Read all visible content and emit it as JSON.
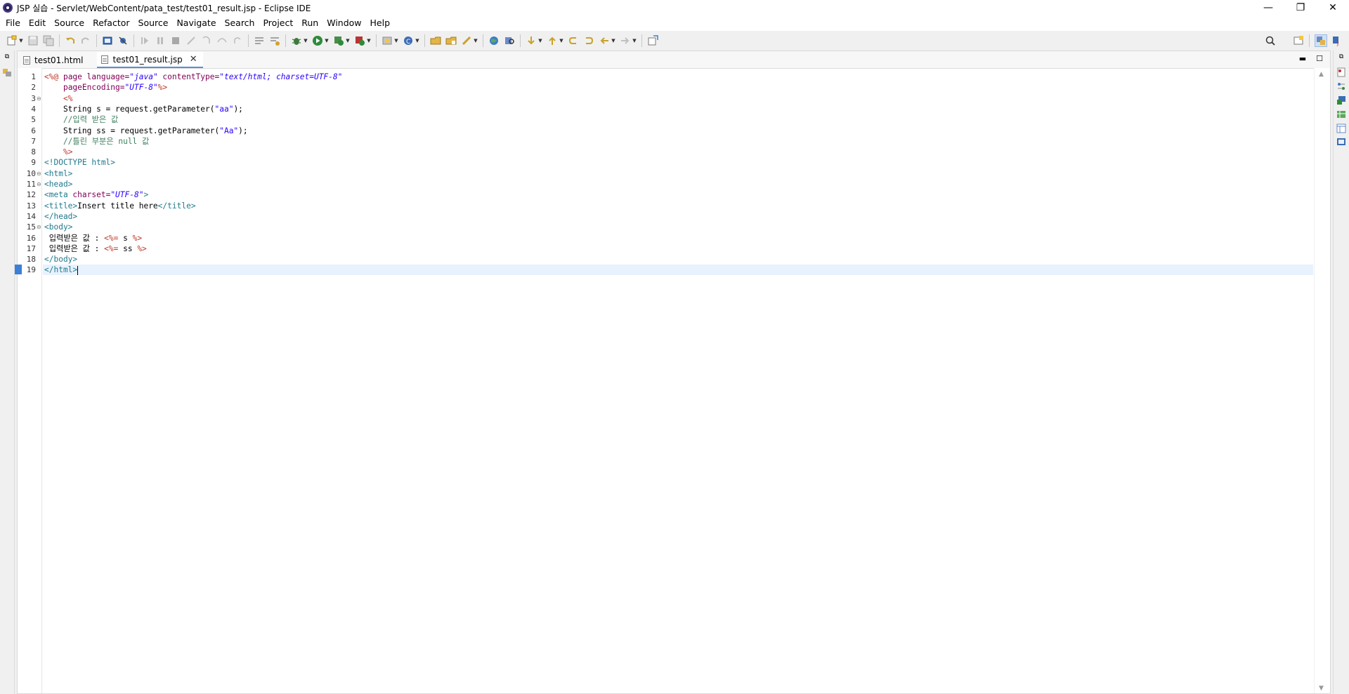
{
  "window": {
    "title": "JSP 실습 - Servlet/WebContent/pata_test/test01_result.jsp - Eclipse IDE",
    "minimize": "—",
    "restore": "❐",
    "close": "✕"
  },
  "menu": [
    "File",
    "Edit",
    "Source",
    "Refactor",
    "Source",
    "Navigate",
    "Search",
    "Project",
    "Run",
    "Window",
    "Help"
  ],
  "tabs": [
    {
      "label": "test01.html",
      "active": false
    },
    {
      "label": "test01_result.jsp",
      "active": true
    }
  ],
  "editor": {
    "current_line": 19,
    "lines": [
      {
        "n": "1",
        "fold": "",
        "parts": [
          [
            "jsp",
            "<%@ "
          ],
          [
            "attr",
            "page "
          ],
          [
            "attr",
            "language="
          ],
          [
            "val",
            "\"java\""
          ],
          [
            "attr",
            " contentType="
          ],
          [
            "val",
            "\"text/html; charset=UTF-8\""
          ]
        ]
      },
      {
        "n": "2",
        "fold": "",
        "parts": [
          [
            "txt",
            "    "
          ],
          [
            "attr",
            "pageEncoding="
          ],
          [
            "val",
            "\"UTF-8\""
          ],
          [
            "jsp",
            "%>"
          ]
        ]
      },
      {
        "n": "3",
        "fold": "⊖",
        "parts": [
          [
            "txt",
            "    "
          ],
          [
            "jsp",
            "<%"
          ]
        ]
      },
      {
        "n": "4",
        "fold": "",
        "parts": [
          [
            "txt",
            "    String s = request.getParameter("
          ],
          [
            "str",
            "\"aa\""
          ],
          [
            "txt",
            ");"
          ]
        ]
      },
      {
        "n": "5",
        "fold": "",
        "parts": [
          [
            "cmt",
            "    //입력 받은 값"
          ]
        ]
      },
      {
        "n": "6",
        "fold": "",
        "parts": [
          [
            "txt",
            "    String ss = request.getParameter("
          ],
          [
            "str",
            "\"Aa\""
          ],
          [
            "txt",
            ");"
          ]
        ]
      },
      {
        "n": "7",
        "fold": "",
        "parts": [
          [
            "cmt",
            "    //틀린 부분은 null 값"
          ]
        ]
      },
      {
        "n": "8",
        "fold": "",
        "parts": [
          [
            "txt",
            "    "
          ],
          [
            "jsp",
            "%>"
          ]
        ]
      },
      {
        "n": "9",
        "fold": "",
        "parts": [
          [
            "tag",
            "<!DOCTYPE html>"
          ]
        ]
      },
      {
        "n": "10",
        "fold": "⊖",
        "parts": [
          [
            "tag",
            "<html>"
          ]
        ]
      },
      {
        "n": "11",
        "fold": "⊖",
        "parts": [
          [
            "tag",
            "<head>"
          ]
        ]
      },
      {
        "n": "12",
        "fold": "",
        "parts": [
          [
            "tag",
            "<meta "
          ],
          [
            "attr",
            "charset="
          ],
          [
            "val",
            "\"UTF-8\""
          ],
          [
            "tag",
            ">"
          ]
        ]
      },
      {
        "n": "13",
        "fold": "",
        "parts": [
          [
            "tag",
            "<title>"
          ],
          [
            "txt",
            "Insert title here"
          ],
          [
            "tag",
            "</title>"
          ]
        ]
      },
      {
        "n": "14",
        "fold": "",
        "parts": [
          [
            "tag",
            "</head>"
          ]
        ]
      },
      {
        "n": "15",
        "fold": "⊖",
        "parts": [
          [
            "tag",
            "<body>"
          ]
        ]
      },
      {
        "n": "16",
        "fold": "",
        "parts": [
          [
            "txt",
            " 입력받은 값 : "
          ],
          [
            "jsp",
            "<%= "
          ],
          [
            "txt",
            "s "
          ],
          [
            "jsp",
            "%>"
          ]
        ]
      },
      {
        "n": "17",
        "fold": "",
        "parts": [
          [
            "txt",
            " 입력받은 값 : "
          ],
          [
            "jsp",
            "<%= "
          ],
          [
            "txt",
            "ss "
          ],
          [
            "jsp",
            "%>"
          ]
        ]
      },
      {
        "n": "18",
        "fold": "",
        "parts": [
          [
            "tag",
            "</body>"
          ]
        ]
      },
      {
        "n": "19",
        "fold": "",
        "parts": [
          [
            "tag",
            "</html>"
          ]
        ]
      }
    ]
  },
  "colors": {
    "accent": "#5b8fd6",
    "current_line": "#e8f2fe"
  }
}
